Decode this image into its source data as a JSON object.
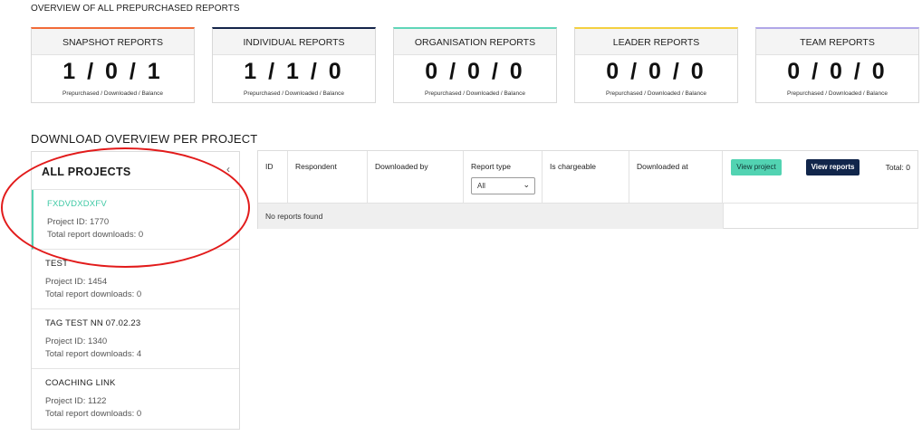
{
  "overview": {
    "heading": "OVERVIEW OF ALL PREPURCHASED REPORTS",
    "cards": [
      {
        "title": "SNAPSHOT REPORTS",
        "value": "1 / 0 / 1",
        "caption": "Prepurchased / Downloaded / Balance",
        "accent": "#f26b38"
      },
      {
        "title": "INDIVIDUAL REPORTS",
        "value": "1 / 1 / 0",
        "caption": "Prepurchased / Downloaded / Balance",
        "accent": "#14254a"
      },
      {
        "title": "ORGANISATION REPORTS",
        "value": "0 / 0 / 0",
        "caption": "Prepurchased / Downloaded / Balance",
        "accent": "#5fd6b8"
      },
      {
        "title": "LEADER REPORTS",
        "value": "0 / 0 / 0",
        "caption": "Prepurchased / Downloaded / Balance",
        "accent": "#f4d03f"
      },
      {
        "title": "TEAM REPORTS",
        "value": "0 / 0 / 0",
        "caption": "Prepurchased / Downloaded / Balance",
        "accent": "#b0a6e8"
      }
    ]
  },
  "download": {
    "heading": "DOWNLOAD OVERVIEW PER PROJECT"
  },
  "projects": {
    "title": "ALL PROJECTS",
    "items": [
      {
        "name": "FXDVDXDXFV",
        "project_id": "Project ID: 1770",
        "downloads": "Total report downloads: 0",
        "active": true
      },
      {
        "name": "TEST",
        "project_id": "Project ID: 1454",
        "downloads": "Total report downloads: 0",
        "active": false
      },
      {
        "name": "TAG TEST NN 07.02.23",
        "project_id": "Project ID: 1340",
        "downloads": "Total report downloads: 4",
        "active": false
      },
      {
        "name": "COACHING LINK",
        "project_id": "Project ID: 1122",
        "downloads": "Total report downloads: 0",
        "active": false
      }
    ]
  },
  "table": {
    "columns": [
      "ID",
      "Respondent",
      "Downloaded by",
      "Report type",
      "Is chargeable",
      "Downloaded at"
    ],
    "report_type_selected": "All",
    "view_project_label": "View project",
    "view_reports_label": "View reports",
    "total": "Total: 0",
    "empty_message": "No reports found"
  },
  "colors": {
    "accent_green": "#52d3b2",
    "navy": "#11264b",
    "annotation_red": "#e21b1b"
  }
}
